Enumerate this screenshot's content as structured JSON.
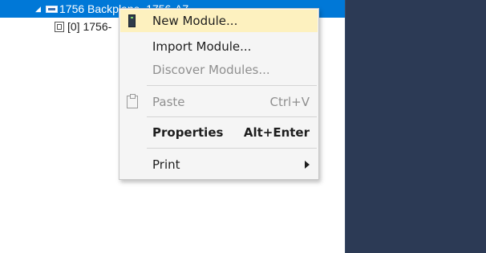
{
  "tree": {
    "backplane_label": "1756 Backplane, 1756-A7",
    "module_label": "[0] 1756-"
  },
  "context_menu": {
    "items": [
      {
        "label": "New Module...",
        "state": "highlighted"
      },
      {
        "label": "Import Module...",
        "state": "enabled"
      },
      {
        "label": "Discover Modules...",
        "state": "disabled"
      },
      {
        "label": "Paste",
        "shortcut": "Ctrl+V",
        "state": "disabled"
      },
      {
        "label": "Properties",
        "shortcut": "Alt+Enter",
        "state": "bold"
      },
      {
        "label": "Print",
        "state": "submenu"
      }
    ]
  },
  "colors": {
    "selection": "#0078d7",
    "menu_highlight": "#fdf1bf",
    "dark_pane": "#2c3a55"
  }
}
